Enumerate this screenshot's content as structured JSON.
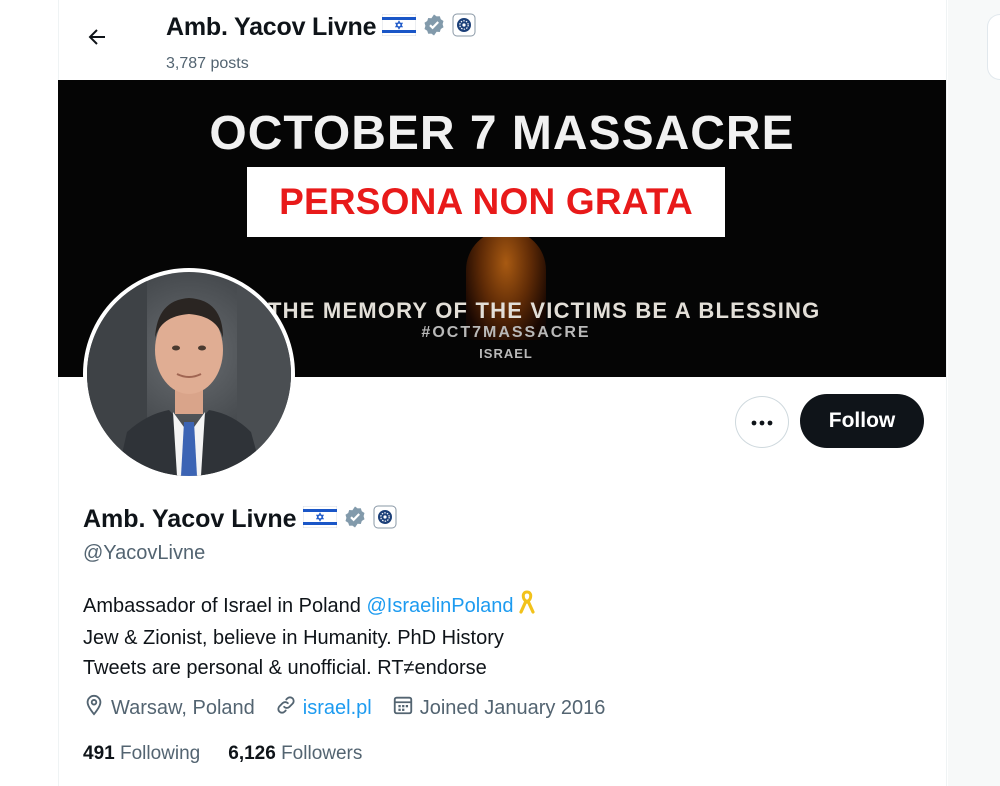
{
  "header": {
    "name": "Amb. Yacov Livne",
    "posts": "3,787 posts"
  },
  "banner": {
    "title": "OCTOBER 7 MASSACRE",
    "memory": "THE MEMORY OF THE VICTIMS BE A BLESSING",
    "hashtag": "#OCT7MASSACRE",
    "logo": "ISRAEL"
  },
  "overlay": {
    "text": "PERSONA NON GRATA",
    "color": "#e81a1a"
  },
  "actions": {
    "follow_label": "Follow",
    "more_label": "•••"
  },
  "profile": {
    "name": "Amb. Yacov Livne",
    "handle": "@YacovLivne",
    "bio": {
      "line1_text": "Ambassador of Israel in Poland ",
      "line1_mention": "@IsraelinPoland",
      "line2": "Jew & Zionist, believe in Humanity. PhD History",
      "line3": "Tweets are personal & unofficial. RT≠endorse"
    },
    "location": "Warsaw, Poland",
    "website": "israel.pl",
    "joined": "Joined January 2016",
    "following_count": "491",
    "following_label": "Following",
    "followers_count": "6,126",
    "followers_label": "Followers"
  },
  "icons": [
    "back-arrow-icon",
    "israel-flag-icon",
    "verified-badge-icon",
    "government-affiliation-icon",
    "yellow-ribbon-icon",
    "location-pin-icon",
    "link-icon",
    "calendar-icon",
    "more-dots-icon"
  ],
  "colors": {
    "link": "#1d9bf0",
    "verified_gray": "#829aab",
    "text": "#0f1419",
    "secondary": "#536471"
  }
}
